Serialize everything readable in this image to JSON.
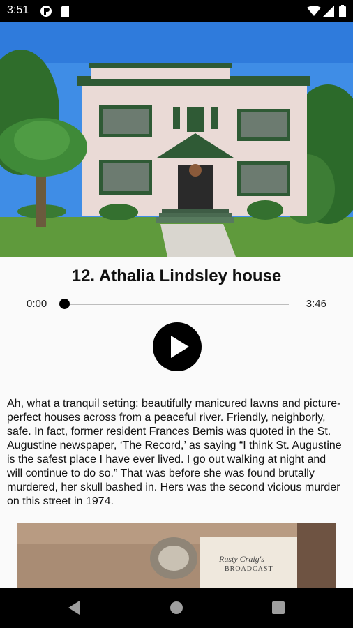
{
  "status_bar": {
    "time": "3:51",
    "left_icons": [
      "app-notification-icon",
      "sd-card-icon"
    ],
    "right_icons": [
      "wifi-icon",
      "cellular-signal-icon",
      "battery-icon"
    ]
  },
  "hero_image": {
    "subject": "house-photo"
  },
  "stop": {
    "title": "12. Athalia Lindsley house"
  },
  "player": {
    "current_time": "0:00",
    "total_time": "3:46",
    "progress": 0,
    "play_icon": "play-icon"
  },
  "description": "Ah, what a tranquil setting: beautifully manicured lawns and picture-perfect houses across from a peaceful river. Friendly, neighborly, safe. In fact, former resident Frances Bemis was quoted in the St. Augustine newspaper, ‘The Record,’ as saying “I think St. Augustine is the safest place I have ever lived. I go out walking at night and will continue to do so.” That was before she was found brutally murdered, her skull bashed in. Hers was the second vicious murder on this street in 1974.",
  "second_photo": {
    "visible_text_line1": "Rusty Craig's",
    "visible_text_line2": "BROADCAST"
  },
  "nav_bar": {
    "icons": [
      "back-icon",
      "home-icon",
      "recents-icon"
    ]
  },
  "colors": {
    "sky": "#3f8de6",
    "house": "#eadad6",
    "trim": "#2f5a35",
    "accent": "#000000"
  }
}
